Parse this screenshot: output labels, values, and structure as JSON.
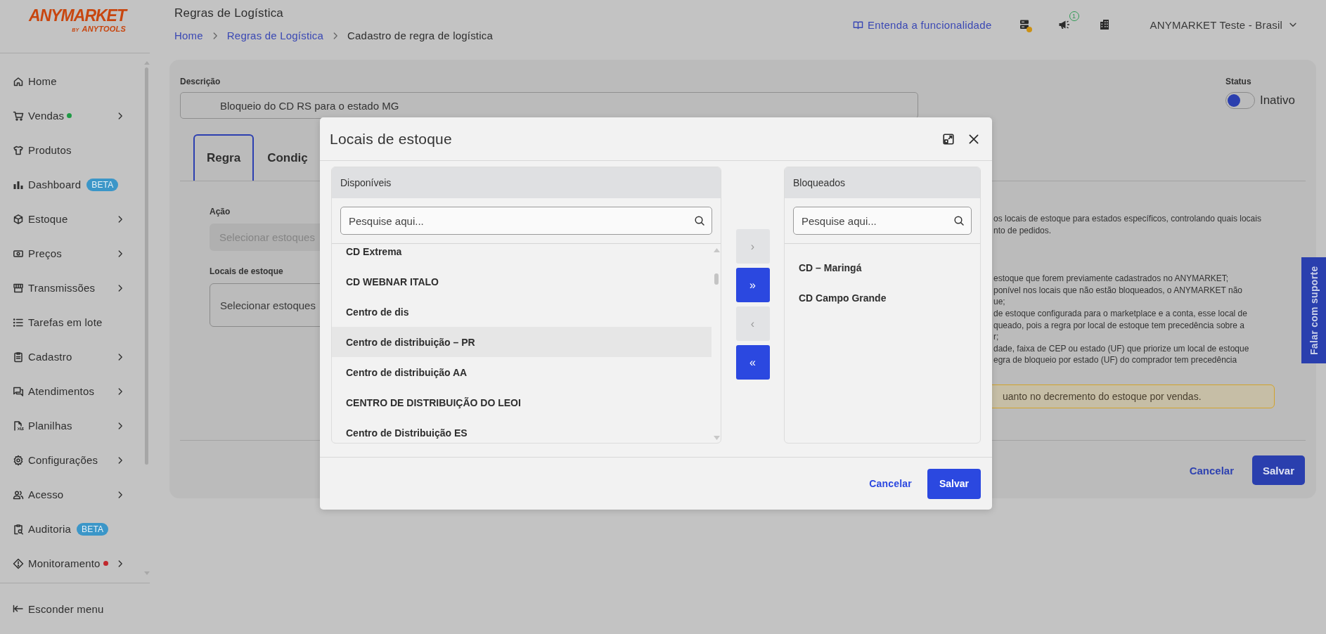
{
  "logo": {
    "name": "ANYMARKET",
    "by": "BY",
    "sub": "ANYTOOLS"
  },
  "sidebar": {
    "items": [
      {
        "label": "Home",
        "expandable": false
      },
      {
        "label": "Vendas",
        "color": "#1f9a45",
        "expandable": true
      },
      {
        "label": "Produtos",
        "expandable": false
      },
      {
        "label": "Dashboard",
        "badge": "BETA",
        "expandable": false
      },
      {
        "label": "Estoque",
        "expandable": true
      },
      {
        "label": "Preços",
        "expandable": true
      },
      {
        "label": "Transmissões",
        "expandable": true
      },
      {
        "label": "Tarefas em lote",
        "expandable": false
      },
      {
        "label": "Cadastro",
        "expandable": true
      },
      {
        "label": "Atendimentos",
        "expandable": true
      },
      {
        "label": "Planilhas",
        "expandable": true
      },
      {
        "label": "Configurações",
        "expandable": true
      },
      {
        "label": "Acesso",
        "expandable": true
      },
      {
        "label": "Auditoria",
        "badge": "BETA",
        "expandable": false
      },
      {
        "label": "Monitoramento",
        "color": "#c0282d",
        "expandable": true
      }
    ],
    "hide_menu": "Esconder menu"
  },
  "header": {
    "title": "Regras de Logística",
    "breadcrumb": [
      {
        "label": "Home",
        "link": true
      },
      {
        "label": "Regras de Logística",
        "link": true
      },
      {
        "label": "Cadastro de regra de logística",
        "link": false
      }
    ],
    "help_link": "Entenda a funcionalidade",
    "notifications": "1",
    "account": "ANYMARKET Teste - Brasil"
  },
  "form": {
    "description_label": "Descrição",
    "description_value": "Bloqueio do CD RS para o estado MG",
    "status_label": "Status",
    "status": {
      "on": false,
      "label": "Inativo"
    },
    "tabs": [
      {
        "label": "Regra",
        "selected": true
      },
      {
        "label": "Condiç",
        "selected": false
      }
    ],
    "action_label": "Ação",
    "action_placeholder": "Selecionar estoques",
    "locations_label": "Locais de estoque",
    "locations_placeholder": "Selecionar estoques",
    "info_groups": [
      [
        "os locais de estoque para estados específicos, controlando quais locais",
        "nto de pedidos."
      ],
      [
        "estoque que forem previamente cadastrados no ANYMARKET;",
        "ponível nos locais que não estão bloqueados, o ANYMARKET não",
        "ue;",
        "de estoque configurada para o marketplace e a conta, esse local de",
        "queado, pois a regra por local de estoque tem precedência sobre a",
        "r;",
        "dade, faixa de CEP ou estado (UF) que priorize um local de estoque",
        "egra de bloqueio por estado (UF) do comprador tem precedência"
      ]
    ],
    "warning": "uanto no decremento do estoque por vendas.",
    "cancel": "Cancelar",
    "save": "Salvar"
  },
  "support_tab": "Falar com suporte",
  "modal": {
    "title": "Locais de estoque",
    "available": {
      "title": "Disponíveis",
      "placeholder": "Pesquise aqui...",
      "items": [
        {
          "label": "CD Extrema",
          "selected": false
        },
        {
          "label": "CD WEBNAR ITALO",
          "selected": false
        },
        {
          "label": "Centro de dis",
          "selected": false
        },
        {
          "label": "Centro de distribuição – PR",
          "selected": true
        },
        {
          "label": "Centro de distribuição AA",
          "selected": false
        },
        {
          "label": "CENTRO DE DISTRIBUIÇÃO DO LEOI",
          "selected": false
        },
        {
          "label": "Centro de Distribuição ES",
          "selected": false
        }
      ]
    },
    "transfer_buttons": [
      {
        "label": "›",
        "disabled": true
      },
      {
        "label": "»",
        "disabled": false
      },
      {
        "label": "‹",
        "disabled": true
      },
      {
        "label": "«",
        "disabled": false
      }
    ],
    "blocked": {
      "title": "Bloqueados",
      "placeholder": "Pesquise aqui...",
      "items": [
        {
          "label": "CD – Maringá",
          "selected": false
        },
        {
          "label": "CD Campo Grande",
          "selected": false
        }
      ]
    },
    "cancel": "Cancelar",
    "save": "Salvar"
  }
}
